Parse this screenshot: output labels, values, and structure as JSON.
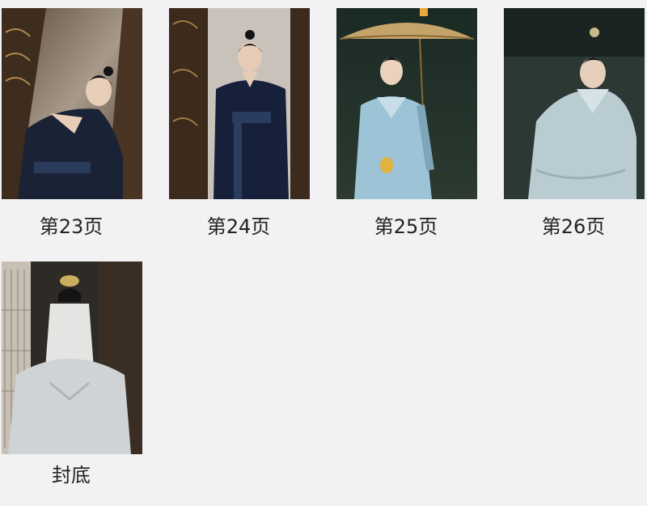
{
  "gallery": {
    "items": [
      {
        "caption": "第23页",
        "thumbnail": "dark-robe-figure-at-wooden-door"
      },
      {
        "caption": "第24页",
        "thumbnail": "dark-robe-figure-standing-in-doorway"
      },
      {
        "caption": "第25页",
        "thumbnail": "light-blue-robe-figure-with-umbrella"
      },
      {
        "caption": "第26页",
        "thumbnail": "pale-robe-figure-seated"
      },
      {
        "caption": "封底",
        "thumbnail": "white-robe-figure-with-veil"
      }
    ]
  }
}
